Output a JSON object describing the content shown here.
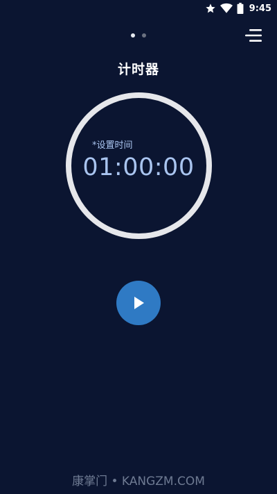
{
  "status_bar": {
    "time": "9:45",
    "icons": [
      "star-icon",
      "wifi-icon",
      "battery-icon"
    ]
  },
  "pager": {
    "count": 2,
    "active_index": 0
  },
  "header": {
    "title": "计时器",
    "menu_icon": "menu-icon"
  },
  "timer": {
    "label": "*设置时间",
    "value": "01:00:00"
  },
  "controls": {
    "play_icon": "play-icon"
  },
  "watermark": {
    "text": "康掌门 • KANGZM.COM"
  },
  "colors": {
    "background": "#0b1531",
    "ring": "#e6e7eb",
    "time_text": "#a9c4ef",
    "play_button": "#2f7ac4",
    "watermark": "#6e7a92"
  }
}
